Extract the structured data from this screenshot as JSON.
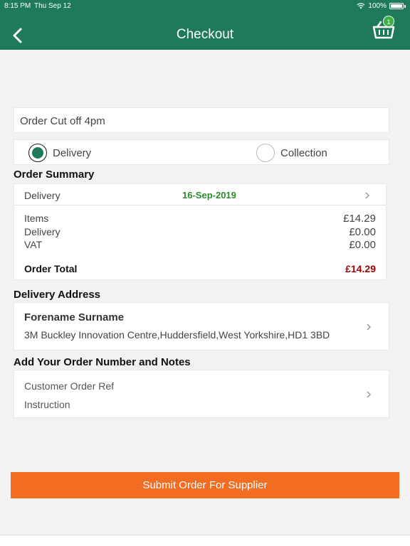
{
  "status_bar": {
    "time": "8:15 PM",
    "date": "Thu Sep 12",
    "battery": "100%"
  },
  "nav": {
    "title": "Checkout",
    "back_icon": "chevron-left-icon",
    "basket_icon": "basket-icon",
    "basket_count": "1"
  },
  "colors": {
    "header": "#1f7a5c",
    "accent_green": "#2a8c2a",
    "total_red": "#a00000",
    "submit_orange": "#f26d22"
  },
  "cutoff": {
    "text": "Order Cut off 4pm"
  },
  "fulfilment": {
    "options": [
      {
        "label": "Delivery",
        "selected": true
      },
      {
        "label": "Collection",
        "selected": false
      }
    ]
  },
  "order_summary": {
    "title": "Order Summary",
    "delivery_label": "Delivery",
    "delivery_date": "16-Sep-2019",
    "items_label": "Items",
    "items_value": "£14.29",
    "delivery_fee_label": "Delivery",
    "delivery_fee_value": "£0.00",
    "vat_label": "VAT",
    "vat_value": "£0.00",
    "total_label": "Order Total",
    "total_value": "£14.29"
  },
  "delivery_address": {
    "title": "Delivery Address",
    "name": "Forename Surname",
    "address": "3M Buckley Innovation Centre,Huddersfield,West Yorkshire,HD1 3BD"
  },
  "notes": {
    "title": "Add Your Order Number and Notes",
    "order_ref_label": "Customer Order Ref",
    "instruction_label": "Instruction"
  },
  "submit": {
    "label": "Submit Order For Supplier"
  }
}
